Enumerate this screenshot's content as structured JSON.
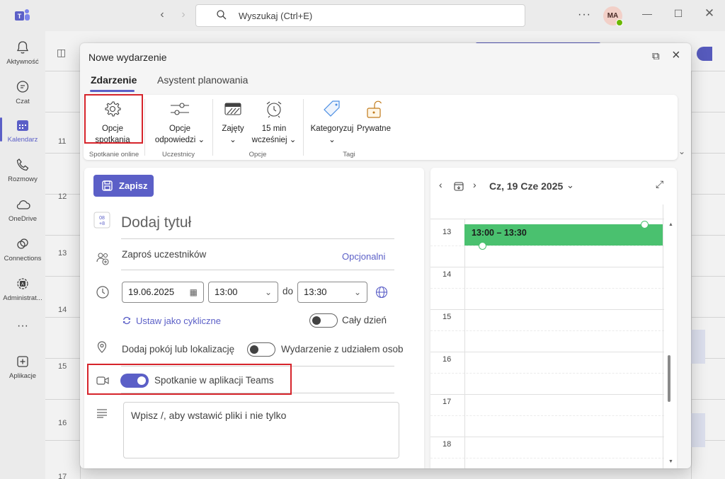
{
  "titlebar": {
    "search_placeholder": "Wyszukaj (Ctrl+E)",
    "more": "···",
    "avatar_initials": "MA"
  },
  "rail": {
    "items": [
      {
        "label": "Aktywność",
        "icon": "bell-icon"
      },
      {
        "label": "Czat",
        "icon": "chat-icon"
      },
      {
        "label": "Kalendarz",
        "icon": "calendar-icon"
      },
      {
        "label": "Rozmowy",
        "icon": "phone-icon"
      },
      {
        "label": "OneDrive",
        "icon": "cloud-icon"
      },
      {
        "label": "Connections",
        "icon": "connections-icon"
      },
      {
        "label": "Administrat...",
        "icon": "admin-icon"
      },
      {
        "label": "···",
        "icon": "more-icon"
      },
      {
        "label": "Aplikacje",
        "icon": "add-apps-icon"
      }
    ],
    "active": "Kalendarz"
  },
  "background_calendar": {
    "hours": [
      "11",
      "12",
      "13",
      "14",
      "15",
      "16",
      "17"
    ]
  },
  "dialog": {
    "title": "Nowe wydarzenie",
    "tabs": [
      {
        "label": "Zdarzenie",
        "active": true
      },
      {
        "label": "Asystent planowania",
        "active": false
      }
    ],
    "ribbon": {
      "buttons": [
        {
          "line1": "Opcje",
          "line2": "spotkania",
          "icon": "gear-icon",
          "highlighted": true
        },
        {
          "line1": "Opcje",
          "line2": "odpowiedzi ⌄",
          "icon": "sliders-icon"
        },
        {
          "line1": "Zajęty",
          "line2": "⌄",
          "icon": "busy-icon"
        },
        {
          "line1": "15 min",
          "line2": "wcześniej ⌄",
          "icon": "alarm-clock-icon"
        },
        {
          "line1": "Kategoryzuj",
          "line2": "⌄",
          "icon": "tag-icon"
        },
        {
          "line1": "Prywatne",
          "line2": "",
          "icon": "lock-icon"
        }
      ],
      "groups": [
        "Spotkanie online",
        "Uczestnicy",
        "Opcje",
        "Tagi"
      ]
    },
    "form": {
      "save_label": "Zapisz",
      "title_placeholder": "Dodaj tytuł",
      "invite_placeholder": "Zaproś uczestników",
      "optional_link": "Opcjonalni",
      "start_date": "19.06.2025",
      "start_time": "13:00",
      "to_label": "do",
      "end_time": "13:30",
      "recurring_link": "Ustaw jako cykliczne",
      "all_day_label": "Cały dzień",
      "all_day_on": false,
      "location_placeholder": "Dodaj pokój lub lokalizację",
      "in_person_label": "Wydarzenie z udziałem osob",
      "in_person_on": false,
      "teams_meeting_label": "Spotkanie w aplikacji Teams",
      "teams_meeting_on": true,
      "description_placeholder": "Wpisz /, aby wstawić pliki i nie tylko"
    },
    "schedule": {
      "date_label": "Cz, 19 Cze 2025",
      "hours": [
        "13",
        "14",
        "15",
        "16",
        "17",
        "18"
      ],
      "event_label": "13:00 – 13:30"
    }
  },
  "colors": {
    "accent": "#5b5fc7",
    "event_green": "#4ac16f",
    "highlight_red": "#d6242b"
  }
}
